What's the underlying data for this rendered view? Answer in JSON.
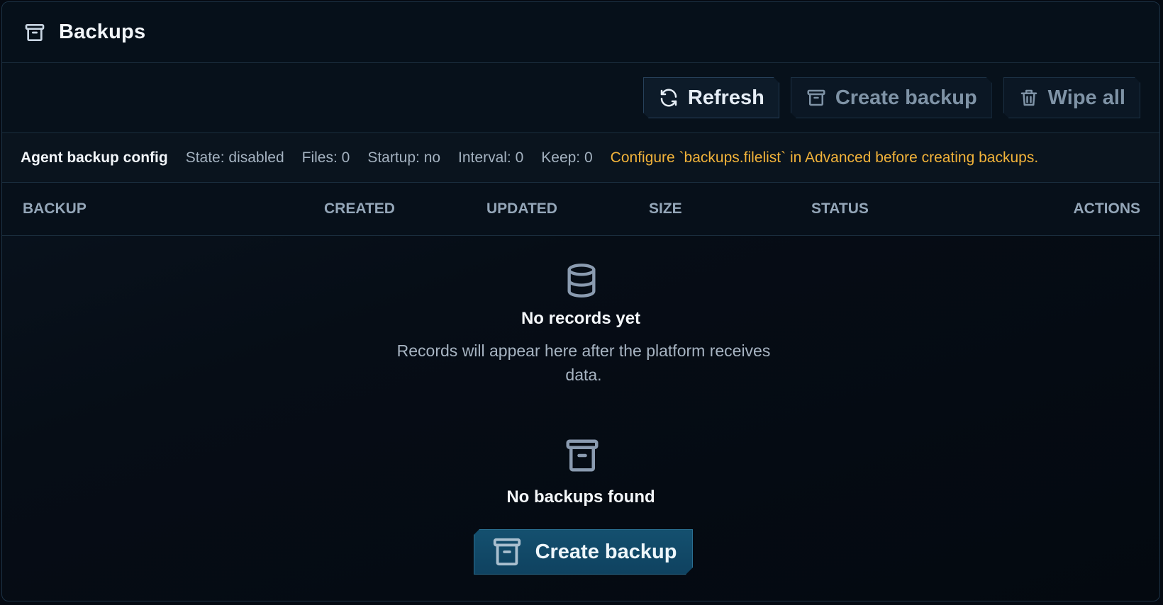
{
  "header": {
    "title": "Backups",
    "icon": "archive-icon"
  },
  "toolbar": {
    "refresh_label": "Refresh",
    "create_label": "Create backup",
    "wipe_label": "Wipe all"
  },
  "config": {
    "label": "Agent backup config",
    "state": "State: disabled",
    "files": "Files: 0",
    "startup": "Startup: no",
    "interval": "Interval: 0",
    "keep": "Keep: 0",
    "warning": "Configure `backups.filelist` in Advanced before creating backups."
  },
  "table": {
    "columns": [
      "BACKUP",
      "CREATED",
      "UPDATED",
      "SIZE",
      "STATUS",
      "ACTIONS"
    ]
  },
  "records_empty": {
    "icon": "database-icon",
    "title": "No records yet",
    "description": "Records will appear here after the platform receives data."
  },
  "backups_empty": {
    "icon": "archive-icon",
    "title": "No backups found",
    "cta_label": "Create backup"
  },
  "colors": {
    "background": "#050a12",
    "warning": "#f2b33a",
    "cta": "#14506f",
    "muted_text": "#a4b2c0"
  }
}
